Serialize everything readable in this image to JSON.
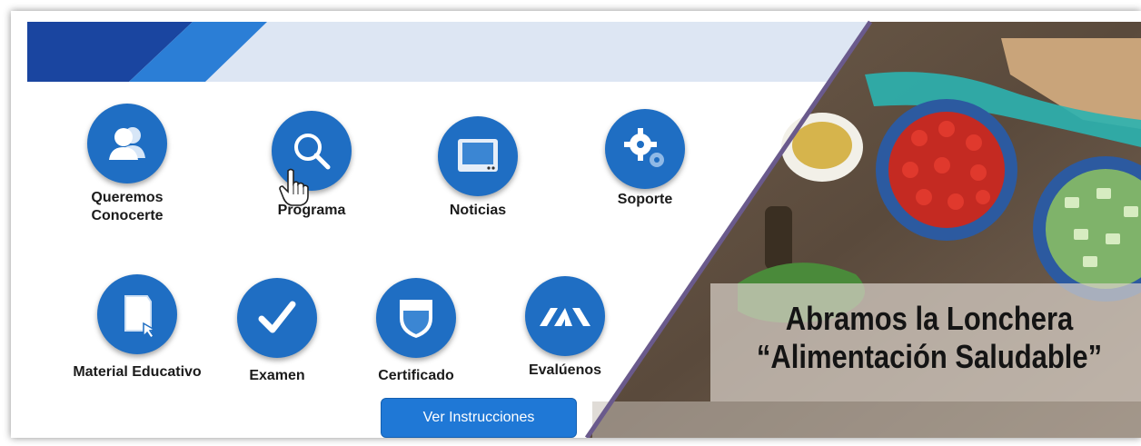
{
  "menu": {
    "items": [
      {
        "label_lines": [
          "Queremos",
          "Conocerte"
        ],
        "icon": "users-icon"
      },
      {
        "label_lines": [
          "Programa"
        ],
        "icon": "search-icon"
      },
      {
        "label_lines": [
          "Noticias"
        ],
        "icon": "monitor-icon"
      },
      {
        "label_lines": [
          "Soporte"
        ],
        "icon": "gears-icon"
      },
      {
        "label_lines": [
          "Material Educativo"
        ],
        "icon": "document-icon"
      },
      {
        "label_lines": [
          "Examen"
        ],
        "icon": "checkmark-icon"
      },
      {
        "label_lines": [
          "Certificado"
        ],
        "icon": "shield-icon"
      },
      {
        "label_lines": [
          "Evalúenos"
        ],
        "icon": "chevrons-icon"
      }
    ]
  },
  "button": {
    "label": "Ver Instrucciones"
  },
  "banner": {
    "line1": "Abramos la Lonchera",
    "line2": "“Alimentación Saludable”"
  },
  "colors": {
    "primary": "#1f6ec3",
    "header_dark": "#1f4fa8",
    "header_light": "#dde6f3",
    "divider": "#6a5a8c"
  }
}
